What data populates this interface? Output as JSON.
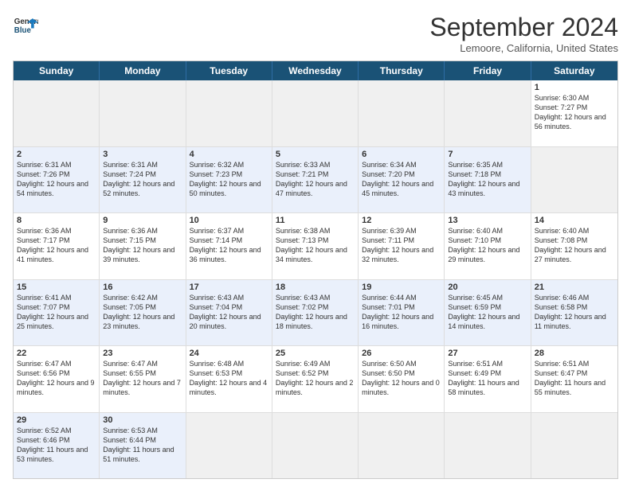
{
  "logo": {
    "line1": "General",
    "line2": "Blue"
  },
  "title": "September 2024",
  "location": "Lemoore, California, United States",
  "headers": [
    "Sunday",
    "Monday",
    "Tuesday",
    "Wednesday",
    "Thursday",
    "Friday",
    "Saturday"
  ],
  "rows": [
    [
      {
        "day": "",
        "empty": true
      },
      {
        "day": "",
        "empty": true
      },
      {
        "day": "",
        "empty": true
      },
      {
        "day": "",
        "empty": true
      },
      {
        "day": "",
        "empty": true
      },
      {
        "day": "",
        "empty": true
      },
      {
        "day": "1",
        "sunrise": "Sunrise: 6:30 AM",
        "sunset": "Sunset: 7:27 PM",
        "daylight": "Daylight: 12 hours and 56 minutes."
      }
    ],
    [
      {
        "day": "2",
        "sunrise": "Sunrise: 6:31 AM",
        "sunset": "Sunset: 7:26 PM",
        "daylight": "Daylight: 12 hours and 54 minutes."
      },
      {
        "day": "3",
        "sunrise": "Sunrise: 6:31 AM",
        "sunset": "Sunset: 7:24 PM",
        "daylight": "Daylight: 12 hours and 52 minutes."
      },
      {
        "day": "4",
        "sunrise": "Sunrise: 6:32 AM",
        "sunset": "Sunset: 7:23 PM",
        "daylight": "Daylight: 12 hours and 50 minutes."
      },
      {
        "day": "5",
        "sunrise": "Sunrise: 6:33 AM",
        "sunset": "Sunset: 7:21 PM",
        "daylight": "Daylight: 12 hours and 47 minutes."
      },
      {
        "day": "6",
        "sunrise": "Sunrise: 6:34 AM",
        "sunset": "Sunset: 7:20 PM",
        "daylight": "Daylight: 12 hours and 45 minutes."
      },
      {
        "day": "7",
        "sunrise": "Sunrise: 6:35 AM",
        "sunset": "Sunset: 7:18 PM",
        "daylight": "Daylight: 12 hours and 43 minutes."
      },
      {
        "day": "",
        "empty": true
      }
    ],
    [
      {
        "day": "8",
        "sunrise": "Sunrise: 6:36 AM",
        "sunset": "Sunset: 7:17 PM",
        "daylight": "Daylight: 12 hours and 41 minutes."
      },
      {
        "day": "9",
        "sunrise": "Sunrise: 6:36 AM",
        "sunset": "Sunset: 7:15 PM",
        "daylight": "Daylight: 12 hours and 39 minutes."
      },
      {
        "day": "10",
        "sunrise": "Sunrise: 6:37 AM",
        "sunset": "Sunset: 7:14 PM",
        "daylight": "Daylight: 12 hours and 36 minutes."
      },
      {
        "day": "11",
        "sunrise": "Sunrise: 6:38 AM",
        "sunset": "Sunset: 7:13 PM",
        "daylight": "Daylight: 12 hours and 34 minutes."
      },
      {
        "day": "12",
        "sunrise": "Sunrise: 6:39 AM",
        "sunset": "Sunset: 7:11 PM",
        "daylight": "Daylight: 12 hours and 32 minutes."
      },
      {
        "day": "13",
        "sunrise": "Sunrise: 6:40 AM",
        "sunset": "Sunset: 7:10 PM",
        "daylight": "Daylight: 12 hours and 29 minutes."
      },
      {
        "day": "14",
        "sunrise": "Sunrise: 6:40 AM",
        "sunset": "Sunset: 7:08 PM",
        "daylight": "Daylight: 12 hours and 27 minutes."
      }
    ],
    [
      {
        "day": "15",
        "sunrise": "Sunrise: 6:41 AM",
        "sunset": "Sunset: 7:07 PM",
        "daylight": "Daylight: 12 hours and 25 minutes."
      },
      {
        "day": "16",
        "sunrise": "Sunrise: 6:42 AM",
        "sunset": "Sunset: 7:05 PM",
        "daylight": "Daylight: 12 hours and 23 minutes."
      },
      {
        "day": "17",
        "sunrise": "Sunrise: 6:43 AM",
        "sunset": "Sunset: 7:04 PM",
        "daylight": "Daylight: 12 hours and 20 minutes."
      },
      {
        "day": "18",
        "sunrise": "Sunrise: 6:43 AM",
        "sunset": "Sunset: 7:02 PM",
        "daylight": "Daylight: 12 hours and 18 minutes."
      },
      {
        "day": "19",
        "sunrise": "Sunrise: 6:44 AM",
        "sunset": "Sunset: 7:01 PM",
        "daylight": "Daylight: 12 hours and 16 minutes."
      },
      {
        "day": "20",
        "sunrise": "Sunrise: 6:45 AM",
        "sunset": "Sunset: 6:59 PM",
        "daylight": "Daylight: 12 hours and 14 minutes."
      },
      {
        "day": "21",
        "sunrise": "Sunrise: 6:46 AM",
        "sunset": "Sunset: 6:58 PM",
        "daylight": "Daylight: 12 hours and 11 minutes."
      }
    ],
    [
      {
        "day": "22",
        "sunrise": "Sunrise: 6:47 AM",
        "sunset": "Sunset: 6:56 PM",
        "daylight": "Daylight: 12 hours and 9 minutes."
      },
      {
        "day": "23",
        "sunrise": "Sunrise: 6:47 AM",
        "sunset": "Sunset: 6:55 PM",
        "daylight": "Daylight: 12 hours and 7 minutes."
      },
      {
        "day": "24",
        "sunrise": "Sunrise: 6:48 AM",
        "sunset": "Sunset: 6:53 PM",
        "daylight": "Daylight: 12 hours and 4 minutes."
      },
      {
        "day": "25",
        "sunrise": "Sunrise: 6:49 AM",
        "sunset": "Sunset: 6:52 PM",
        "daylight": "Daylight: 12 hours and 2 minutes."
      },
      {
        "day": "26",
        "sunrise": "Sunrise: 6:50 AM",
        "sunset": "Sunset: 6:50 PM",
        "daylight": "Daylight: 12 hours and 0 minutes."
      },
      {
        "day": "27",
        "sunrise": "Sunrise: 6:51 AM",
        "sunset": "Sunset: 6:49 PM",
        "daylight": "Daylight: 11 hours and 58 minutes."
      },
      {
        "day": "28",
        "sunrise": "Sunrise: 6:51 AM",
        "sunset": "Sunset: 6:47 PM",
        "daylight": "Daylight: 11 hours and 55 minutes."
      }
    ],
    [
      {
        "day": "29",
        "sunrise": "Sunrise: 6:52 AM",
        "sunset": "Sunset: 6:46 PM",
        "daylight": "Daylight: 11 hours and 53 minutes."
      },
      {
        "day": "30",
        "sunrise": "Sunrise: 6:53 AM",
        "sunset": "Sunset: 6:44 PM",
        "daylight": "Daylight: 11 hours and 51 minutes."
      },
      {
        "day": "",
        "empty": true
      },
      {
        "day": "",
        "empty": true
      },
      {
        "day": "",
        "empty": true
      },
      {
        "day": "",
        "empty": true
      },
      {
        "day": "",
        "empty": true
      }
    ]
  ]
}
